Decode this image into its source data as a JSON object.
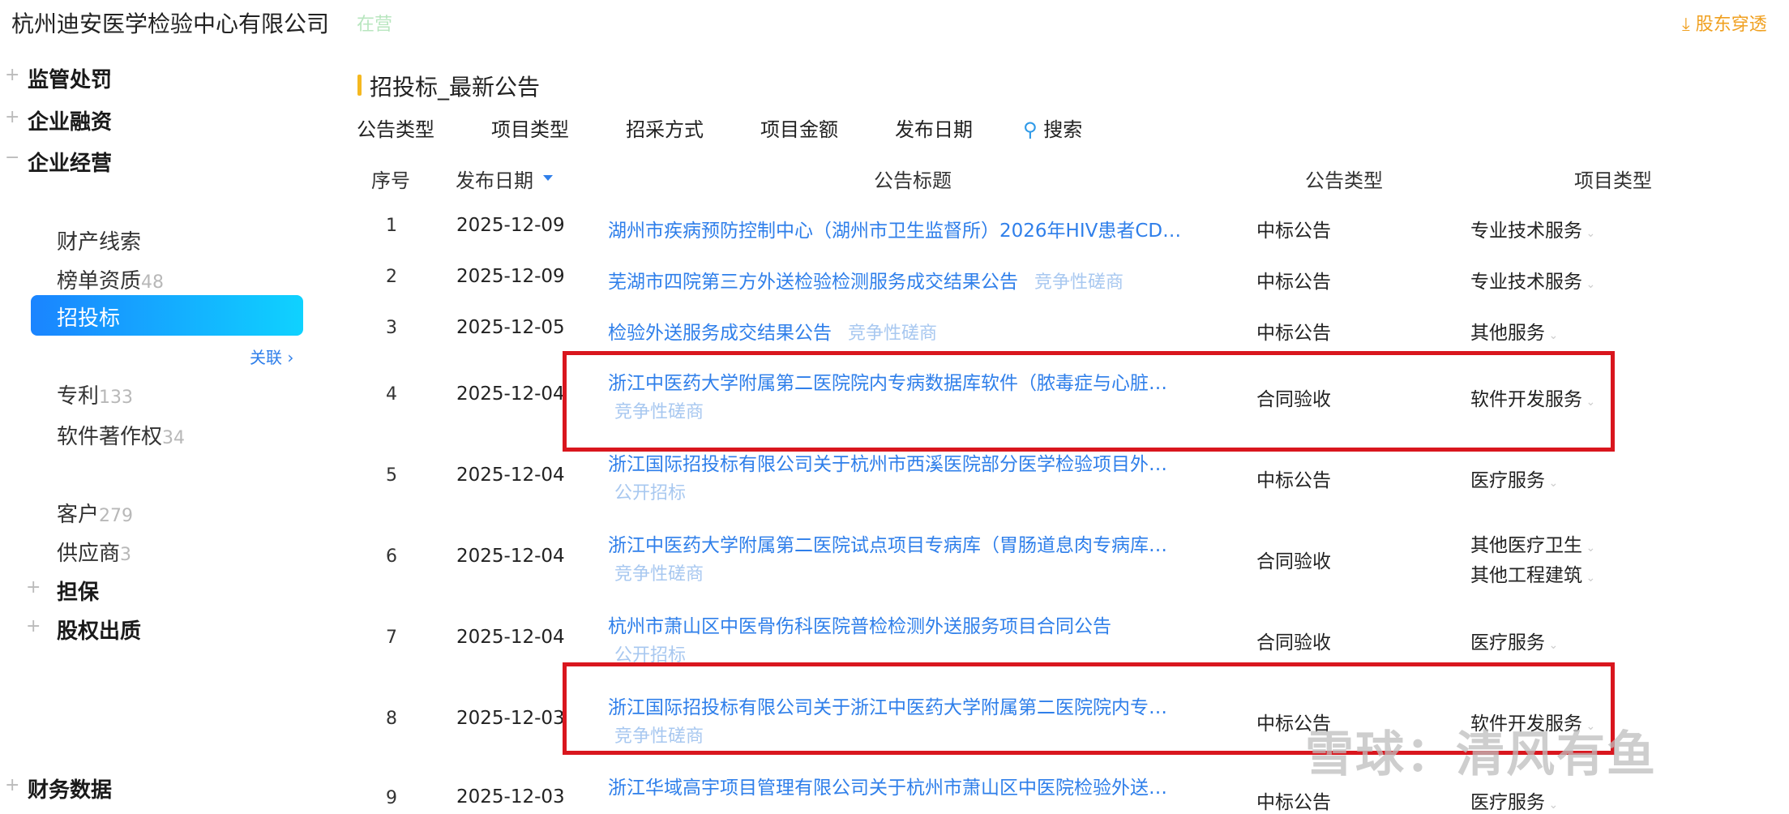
{
  "header": {
    "company": "杭州迪安医学检验中心有限公司",
    "status": "在营",
    "shareholder_link": "股东穿透"
  },
  "sidebar": {
    "sections": {
      "penalty": "监管处罚",
      "financing": "企业融资",
      "operation": "企业经营",
      "guarantee": "担保",
      "equity_pledge": "股权出质",
      "finance_data": "财务数据"
    },
    "items": {
      "property": {
        "label": "财产线索"
      },
      "ranking": {
        "label": "榜单资质",
        "count": "48"
      },
      "bidding": {
        "label": "招投标"
      },
      "related": "关联",
      "patent": {
        "label": "专利",
        "count": "133"
      },
      "software": {
        "label": "软件著作权",
        "count": "34"
      },
      "customer": {
        "label": "客户",
        "count": "279"
      },
      "supplier": {
        "label": "供应商",
        "count": "3"
      }
    }
  },
  "main": {
    "title": "招投标_最新公告",
    "filters": [
      "公告类型",
      "项目类型",
      "招采方式",
      "项目金额",
      "发布日期"
    ],
    "search": "搜索",
    "columns": {
      "seq": "序号",
      "date": "发布日期",
      "title": "公告标题",
      "ann_type": "公告类型",
      "proj_type": "项目类型"
    },
    "rows": [
      {
        "seq": "1",
        "date": "2025-12-09",
        "title": "湖州市疾病预防控制中心（湖州市卫生监督所）2026年HIV患者CD…",
        "tag": "",
        "ann_type": "中标公告",
        "proj_type": [
          "专业技术服务"
        ]
      },
      {
        "seq": "2",
        "date": "2025-12-09",
        "title": "芜湖市四院第三方外送检验检测服务成交结果公告",
        "tag": "竞争性磋商",
        "ann_type": "中标公告",
        "proj_type": [
          "专业技术服务"
        ]
      },
      {
        "seq": "3",
        "date": "2025-12-05",
        "title": "检验外送服务成交结果公告",
        "tag": "竞争性磋商",
        "ann_type": "中标公告",
        "proj_type": [
          "其他服务"
        ]
      },
      {
        "seq": "4",
        "date": "2025-12-04",
        "title": "浙江中医药大学附属第二医院院内专病数据库软件（脓毒症与心脏…",
        "tag": "竞争性磋商",
        "ann_type": "合同验收",
        "proj_type": [
          "软件开发服务"
        ]
      },
      {
        "seq": "5",
        "date": "2025-12-04",
        "title": "浙江国际招投标有限公司关于杭州市西溪医院部分医学检验项目外…",
        "tag": "公开招标",
        "ann_type": "中标公告",
        "proj_type": [
          "医疗服务"
        ]
      },
      {
        "seq": "6",
        "date": "2025-12-04",
        "title": "浙江中医药大学附属第二医院试点项目专病库（胃肠道息肉专病库…",
        "tag": "竞争性磋商",
        "ann_type": "合同验收",
        "proj_type": [
          "其他医疗卫生",
          "其他工程建筑"
        ]
      },
      {
        "seq": "7",
        "date": "2025-12-04",
        "title": "杭州市萧山区中医骨伤科医院普检检测外送服务项目合同公告",
        "tag": "公开招标",
        "ann_type": "合同验收",
        "proj_type": [
          "医疗服务"
        ]
      },
      {
        "seq": "8",
        "date": "2025-12-03",
        "title": "浙江国际招投标有限公司关于浙江中医药大学附属第二医院院内专…",
        "tag": "竞争性磋商",
        "ann_type": "中标公告",
        "proj_type": [
          "软件开发服务"
        ]
      },
      {
        "seq": "9",
        "date": "2025-12-03",
        "title": "浙江华域高宇项目管理有限公司关于杭州市萧山区中医院检验外送…",
        "tag": "",
        "ann_type": "中标公告",
        "proj_type": [
          "医疗服务"
        ]
      }
    ]
  },
  "watermark": "雪球：清风有鱼",
  "colors": {
    "link": "#2f7fea",
    "tag": "#a8c8f0",
    "highlight_box": "#d9161e",
    "active_from": "#1a84ff",
    "active_to": "#0fd2ff",
    "title_bar": "#f5b820"
  }
}
